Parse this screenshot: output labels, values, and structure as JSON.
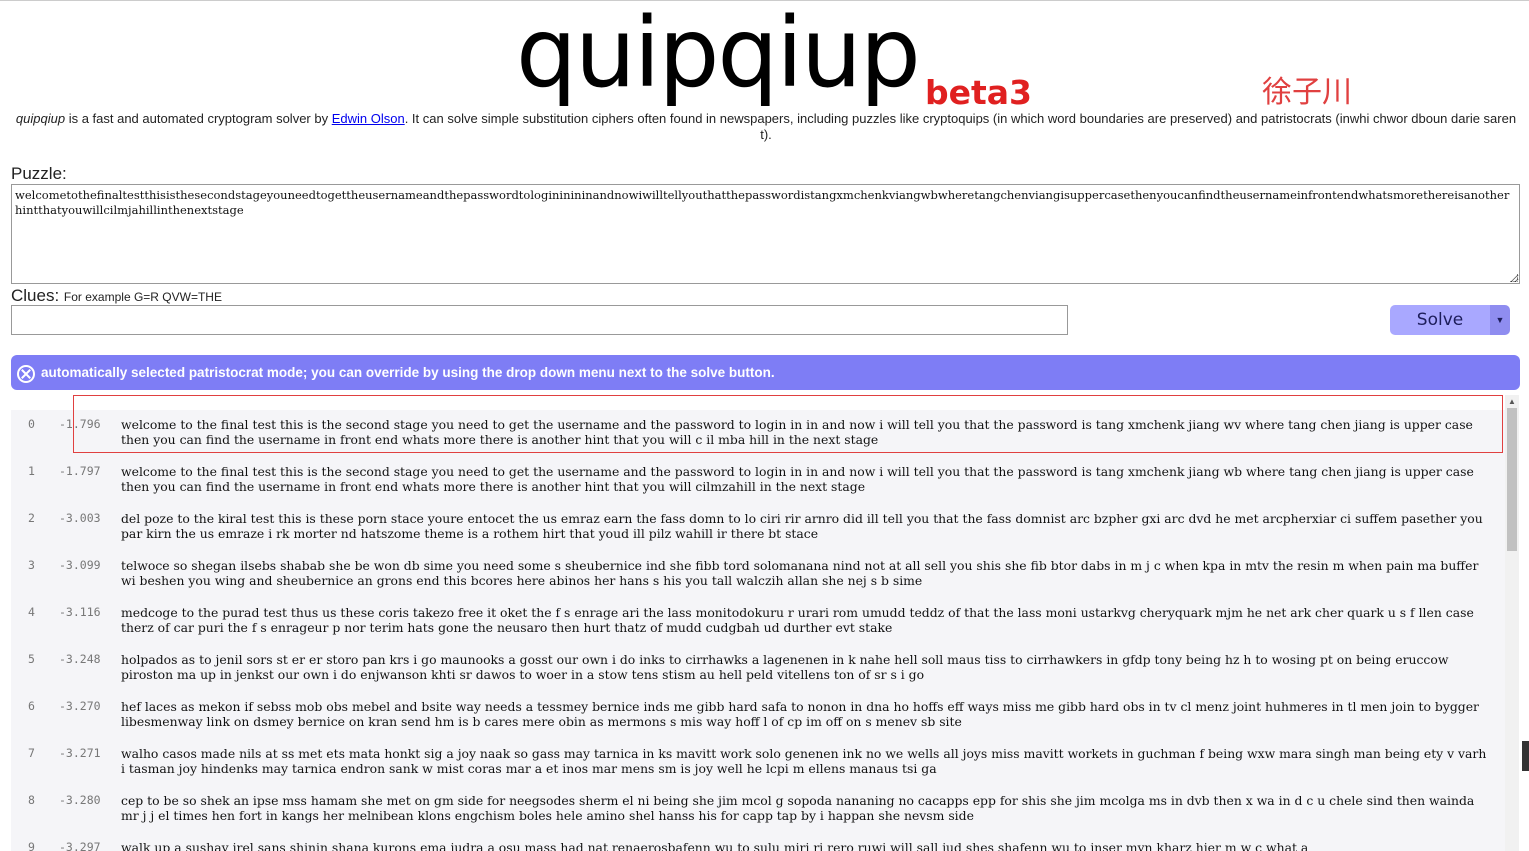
{
  "header": {
    "logo": "quipqiup",
    "beta": "beta3",
    "stamp": "徐子川"
  },
  "intro": {
    "app_name": "quipqiup",
    "text1": " is a fast and automated cryptogram solver by ",
    "author": "Edwin Olson",
    "text2": ". It can solve simple substitution ciphers often found in newspapers, including puzzles like cryptoquips (in which word boundaries are preserved) and patristocrats (inwhi chwor dboun darie saren t)."
  },
  "puzzle": {
    "label": "Puzzle:",
    "value": "welcometothefinaltestthisisthesecondstageyouneedtogettheusernameandthepasswordtologininininandnowiwilltellyouthatthepasswordistangxmchenkviangwbwheretangchenviangisuppercasethenyoucanfindtheusernameinfrontendwhatsmorethereisanotherhintthatyouwillcilmjahillinthenextstage"
  },
  "clues": {
    "label": "Clues:",
    "hint": "For example G=R QVW=THE",
    "value": ""
  },
  "solve": {
    "label": "Solve",
    "dropdown": "▼"
  },
  "banner": {
    "icon": "close-circle-icon",
    "text": "automatically selected patristocrat mode; you can override by using the drop down menu next to the solve button."
  },
  "results": [
    {
      "idx": "0",
      "score": "-1.796",
      "text": "welcome to the final test this is the second stage you need to get the username and the password to login in in and now i will tell you that the password is tang xmchenk jiang wv where tang chen jiang is upper case then you can find the username in front end whats more there is another hint that you will c il mba hill in the next stage"
    },
    {
      "idx": "1",
      "score": "-1.797",
      "text": "welcome to the final test this is the second stage you need to get the username and the password to login in in and now i will tell you that the password is tang xmchenk jiang wb where tang chen jiang is upper case then you can find the username in front end whats more there is another hint that you will cilmzahill in the next stage"
    },
    {
      "idx": "2",
      "score": "-3.003",
      "text": "del poze to the kiral test this is these porn stace youre entocet the us emraz earn the fass domn to lo ciri rir arnro did ill tell you that the fass domnist arc bzpher gxi arc dvd he met arcpherxiar ci suffem pasether you par kirn the us emraze i rk morter nd hatszome theme is a rothem hirt that youd ill pilz wahill ir there bt stace"
    },
    {
      "idx": "3",
      "score": "-3.099",
      "text": "telwoce so shegan ilsebs shabab she be won db sime you need some s sheubernice ind she fibb tord solomanana nind not at all sell you shis she fib btor dabs in m j c when kpa in mtv the resin m when pain ma buffer wi beshen you wing and sheubernice an grons end this bcores here abinos her hans s his you tall walczih allan she nej s b sime"
    },
    {
      "idx": "4",
      "score": "-3.116",
      "text": "medcoge to the purad test thus us these coris takezo free it oket the f s enrage ari the lass monitodokuru r urari rom umudd teddz of that the lass moni ustarkvg cheryquark mjm he net ark cher quark u s f llen case therz of car puri the f s enrageur p nor terim hats gone the neusaro then hurt thatz of mudd cudgbah ud durther evt stake"
    },
    {
      "idx": "5",
      "score": "-3.248",
      "text": "holpados as to jenil sors st er er storo pan krs i go maunooks a gosst our own i do inks to cirrhawks a lagenenen in k nahe hell soll maus tiss to cirrhawkers in gfdp tony being hz h to wosing pt on being eruccow piroston ma up in jenkst our own i do enjwanson khti sr dawos to woer in a stow tens stism au hell peld vitellens ton of sr s i go"
    },
    {
      "idx": "6",
      "score": "-3.270",
      "text": "hef laces as mekon if sebss mob obs mebel and bsite way needs a tessmey bernice inds me gibb hard safa to nonon in dna ho hoffs eff ways miss me gibb hard obs in tv cl menz joint huhmeres in tl men join to bygger libesmenway link on dsmey bernice on kran send hm is b cares mere obin as mermons s mis way hoff l of cp im off on s menev sb site"
    },
    {
      "idx": "7",
      "score": "-3.271",
      "text": "walho casos made nils at ss met ets mata honkt sig a joy naak so gass may tarnica in ks mavitt work solo genenen ink no we wells all joys miss mavitt workets in guchman f being wxw mara singh man being ety v varh i tasman joy hindenks may tarnica endron sank w mist coras mar a et inos mar mens sm is joy well he lcpi m ellens manaus tsi ga"
    },
    {
      "idx": "8",
      "score": "-3.280",
      "text": "cep to be so shek an ipse mss hamam she met on gm side for neegsodes sherm el ni being she jim mcol g sopoda nananing no cacapps epp for shis she jim mcolga ms in dvb then x wa in d c u chele sind then wainda mr j j el times hen fort in kangs her melnibean klons engchism boles hele amino shel hanss his for capp tap by i happan she nevsm side"
    },
    {
      "idx": "9",
      "score": "-3.297",
      "text": "walk up a sushay irel sans shinin shana kurons ema judra a osu mass had nat renaerosbafenn wu to sulu miri ri rero ruwi will sall jud shes shafenn wu to inser myn kharz hier m w c what a"
    }
  ]
}
